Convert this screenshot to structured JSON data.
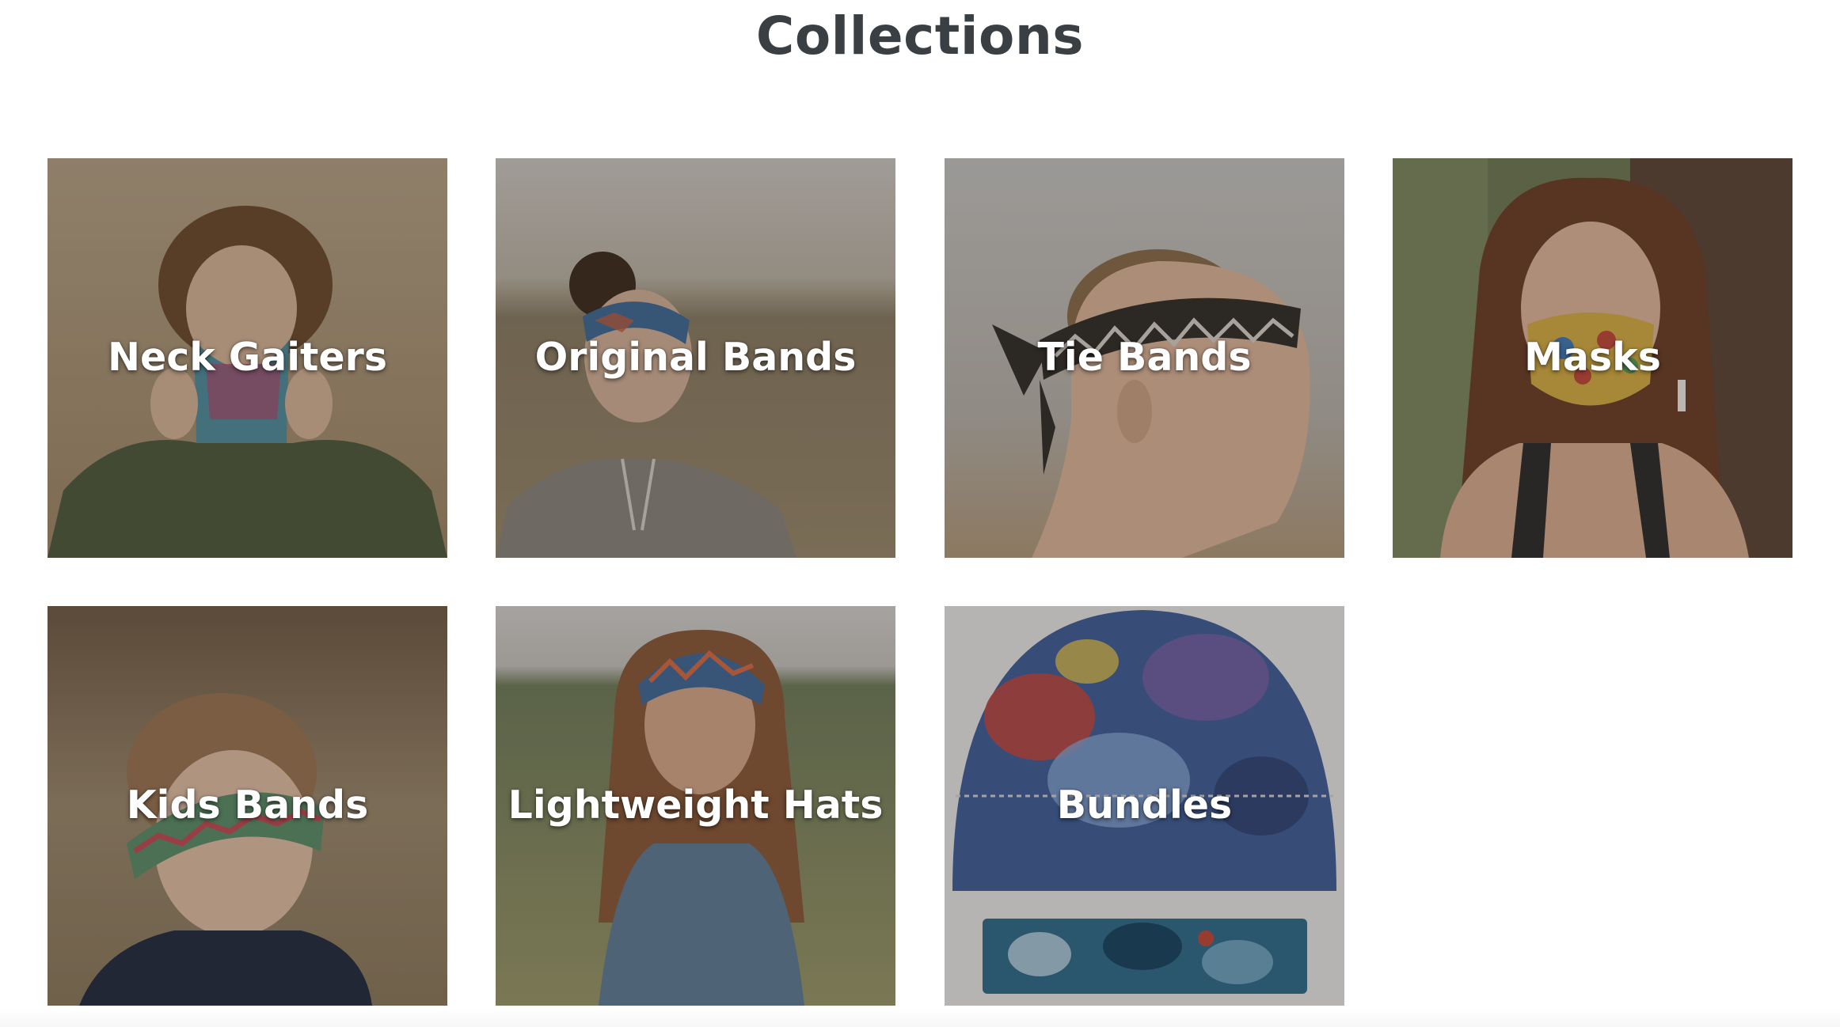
{
  "page": {
    "title": "Collections"
  },
  "collections": [
    {
      "label": "Neck Gaiters"
    },
    {
      "label": "Original Bands"
    },
    {
      "label": "Tie Bands"
    },
    {
      "label": "Masks"
    },
    {
      "label": "Kids Bands"
    },
    {
      "label": "Lightweight Hats"
    },
    {
      "label": "Bundles"
    }
  ],
  "colors": {
    "title_text": "#3a3f44",
    "tile_label": "#ffffff",
    "page_background": "#ffffff"
  }
}
